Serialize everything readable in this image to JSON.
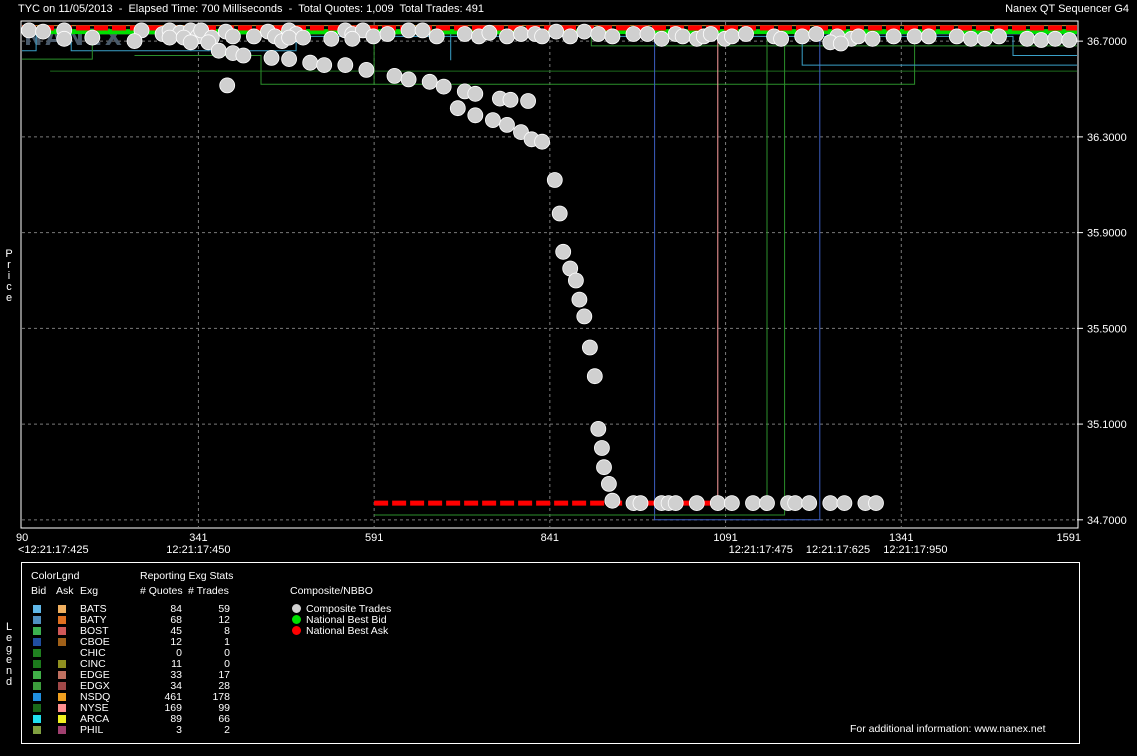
{
  "header": {
    "title_left": "TYC on 11/05/2013  -  Elapsed Time: 700 Milliseconds  -  Total Quotes: 1,009  Total Trades: 491",
    "title_right": "Nanex QT Sequencer G4",
    "watermark": "NANEX"
  },
  "side_labels": {
    "price": [
      "P",
      "r",
      "i",
      "c",
      "e"
    ],
    "legend": [
      "L",
      "e",
      "g",
      "e",
      "n",
      "d"
    ]
  },
  "colors": {
    "composite_trade": "#d0d0d0",
    "best_bid": "#00e000",
    "best_ask": "#ff0000",
    "grid": "#7a7a7a"
  },
  "chart_data": {
    "type": "scatter",
    "ylim": [
      34.67,
      36.78
    ],
    "xlim": [
      90,
      1591
    ],
    "y_ticks": [
      "36.7000",
      "36.3000",
      "35.9000",
      "35.5000",
      "35.1000",
      "34.7000"
    ],
    "y_tick_values": [
      36.7,
      36.3,
      35.9,
      35.5,
      35.1,
      34.7
    ],
    "x_ticks": [
      "90",
      "341",
      "591",
      "841",
      "1091",
      "1341",
      "1591"
    ],
    "x_tick_values": [
      90,
      341,
      591,
      841,
      1091,
      1341,
      1591
    ],
    "time_labels": [
      {
        "text": "<12:21:17:425",
        "x": 90
      },
      {
        "text": "12:21:17:450",
        "x": 341
      },
      {
        "text": "12:21:17:475",
        "x": 1141
      },
      {
        "text": "12:21:17:625",
        "x": 1251
      },
      {
        "text": "12:21:17:950",
        "x": 1361
      }
    ],
    "series": [
      {
        "name": "Composite Trades",
        "points": [
          [
            100,
            36.745
          ],
          [
            120,
            36.74
          ],
          [
            150,
            36.745
          ],
          [
            260,
            36.745
          ],
          [
            290,
            36.73
          ],
          [
            300,
            36.745
          ],
          [
            315,
            36.735
          ],
          [
            330,
            36.745
          ],
          [
            340,
            36.72
          ],
          [
            345,
            36.745
          ],
          [
            380,
            36.74
          ],
          [
            440,
            36.74
          ],
          [
            450,
            36.72
          ],
          [
            470,
            36.745
          ],
          [
            480,
            36.73
          ],
          [
            550,
            36.745
          ],
          [
            560,
            36.73
          ],
          [
            575,
            36.745
          ],
          [
            590,
            36.72
          ],
          [
            610,
            36.73
          ],
          [
            640,
            36.745
          ],
          [
            660,
            36.745
          ],
          [
            680,
            36.72
          ],
          [
            720,
            36.73
          ],
          [
            740,
            36.72
          ],
          [
            755,
            36.735
          ],
          [
            780,
            36.72
          ],
          [
            800,
            36.73
          ],
          [
            820,
            36.73
          ],
          [
            830,
            36.72
          ],
          [
            850,
            36.74
          ],
          [
            870,
            36.72
          ],
          [
            890,
            36.74
          ],
          [
            910,
            36.73
          ],
          [
            930,
            36.72
          ],
          [
            960,
            36.73
          ],
          [
            980,
            36.73
          ],
          [
            1000,
            36.71
          ],
          [
            1020,
            36.73
          ],
          [
            1030,
            36.72
          ],
          [
            1050,
            36.71
          ],
          [
            1060,
            36.72
          ],
          [
            1070,
            36.73
          ],
          [
            1090,
            36.71
          ],
          [
            1100,
            36.72
          ],
          [
            1120,
            36.73
          ],
          [
            1160,
            36.72
          ],
          [
            1170,
            36.71
          ],
          [
            1200,
            36.72
          ],
          [
            1220,
            36.73
          ],
          [
            1250,
            36.72
          ],
          [
            1270,
            36.71
          ],
          [
            1280,
            36.72
          ],
          [
            1300,
            36.71
          ],
          [
            1330,
            36.72
          ],
          [
            1360,
            36.72
          ],
          [
            1380,
            36.72
          ],
          [
            1420,
            36.72
          ],
          [
            1440,
            36.71
          ],
          [
            1460,
            36.71
          ],
          [
            1480,
            36.72
          ],
          [
            1520,
            36.71
          ],
          [
            1540,
            36.705
          ],
          [
            1560,
            36.71
          ],
          [
            1580,
            36.705
          ],
          [
            150,
            36.71
          ],
          [
            190,
            36.715
          ],
          [
            250,
            36.7
          ],
          [
            300,
            36.715
          ],
          [
            320,
            36.715
          ],
          [
            330,
            36.695
          ],
          [
            360,
            36.715
          ],
          [
            390,
            36.72
          ],
          [
            420,
            36.72
          ],
          [
            460,
            36.7
          ],
          [
            470,
            36.715
          ],
          [
            490,
            36.715
          ],
          [
            530,
            36.71
          ],
          [
            560,
            36.71
          ],
          [
            1240,
            36.695
          ],
          [
            1255,
            36.69
          ],
          [
            355,
            36.695
          ],
          [
            370,
            36.66
          ],
          [
            390,
            36.65
          ],
          [
            405,
            36.64
          ],
          [
            445,
            36.63
          ],
          [
            470,
            36.625
          ],
          [
            500,
            36.61
          ],
          [
            520,
            36.6
          ],
          [
            550,
            36.6
          ],
          [
            580,
            36.58
          ],
          [
            620,
            36.555
          ],
          [
            640,
            36.54
          ],
          [
            670,
            36.53
          ],
          [
            690,
            36.51
          ],
          [
            720,
            36.49
          ],
          [
            735,
            36.48
          ],
          [
            770,
            36.46
          ],
          [
            785,
            36.455
          ],
          [
            810,
            36.45
          ],
          [
            382,
            36.515
          ],
          [
            710,
            36.42
          ],
          [
            735,
            36.39
          ],
          [
            760,
            36.37
          ],
          [
            780,
            36.35
          ],
          [
            800,
            36.32
          ],
          [
            815,
            36.29
          ],
          [
            830,
            36.28
          ],
          [
            848,
            36.12
          ],
          [
            855,
            35.98
          ],
          [
            860,
            35.82
          ],
          [
            870,
            35.75
          ],
          [
            878,
            35.7
          ],
          [
            883,
            35.62
          ],
          [
            890,
            35.55
          ],
          [
            898,
            35.42
          ],
          [
            905,
            35.3
          ],
          [
            910,
            35.08
          ],
          [
            915,
            35.0
          ],
          [
            918,
            34.92
          ],
          [
            925,
            34.85
          ],
          [
            930,
            34.78
          ],
          [
            960,
            34.77
          ],
          [
            970,
            34.77
          ],
          [
            1000,
            34.77
          ],
          [
            1010,
            34.77
          ],
          [
            1020,
            34.77
          ],
          [
            1050,
            34.77
          ],
          [
            1080,
            34.77
          ],
          [
            1100,
            34.77
          ],
          [
            1130,
            34.77
          ],
          [
            1150,
            34.77
          ],
          [
            1180,
            34.77
          ],
          [
            1190,
            34.77
          ],
          [
            1210,
            34.77
          ],
          [
            1240,
            34.77
          ],
          [
            1260,
            34.77
          ],
          [
            1290,
            34.77
          ],
          [
            1305,
            34.77
          ]
        ]
      },
      {
        "name": "National Best Bid",
        "segments": [
          [
            [
              90,
              36.74
            ],
            [
              1591,
              36.74
            ]
          ]
        ]
      },
      {
        "name": "National Best Ask",
        "segments": [
          [
            [
              90,
              36.755
            ],
            [
              1591,
              36.755
            ]
          ],
          [
            [
              591,
              34.77
            ],
            [
              1110,
              34.77
            ]
          ]
        ]
      }
    ],
    "exchange_lines": [
      {
        "color": "#3aa0c8",
        "points": [
          [
            90,
            36.66
          ],
          [
            110,
            36.66
          ],
          [
            110,
            36.74
          ],
          [
            160,
            36.74
          ],
          [
            160,
            36.66
          ],
          [
            480,
            36.66
          ],
          [
            480,
            36.72
          ],
          [
            1500,
            36.72
          ],
          [
            1500,
            36.64
          ],
          [
            1591,
            36.64
          ]
        ]
      },
      {
        "color": "#2b8f2b",
        "points": [
          [
            90,
            36.625
          ],
          [
            190,
            36.625
          ],
          [
            190,
            36.73
          ],
          [
            900,
            36.73
          ],
          [
            900,
            36.68
          ],
          [
            1591,
            36.68
          ]
        ]
      },
      {
        "color": "#1c6b1c",
        "points": [
          [
            130,
            36.575
          ],
          [
            1591,
            36.575
          ]
        ]
      },
      {
        "color": "#2b8f2b",
        "points": [
          [
            250,
            36.64
          ],
          [
            430,
            36.64
          ],
          [
            430,
            36.52
          ],
          [
            1360,
            36.52
          ],
          [
            1360,
            36.73
          ],
          [
            1591,
            36.73
          ]
        ]
      },
      {
        "color": "#3c5ec0",
        "points": [
          [
            990,
            36.73
          ],
          [
            990,
            34.7
          ],
          [
            1225,
            34.7
          ],
          [
            1225,
            36.73
          ],
          [
            1591,
            36.73
          ]
        ]
      },
      {
        "color": "#2b8f2b",
        "points": [
          [
            591,
            34.72
          ],
          [
            1175,
            34.72
          ],
          [
            1175,
            36.72
          ]
        ]
      },
      {
        "color": "#3aa0c8",
        "points": [
          [
            700,
            36.62
          ],
          [
            700,
            36.74
          ],
          [
            1200,
            36.74
          ],
          [
            1200,
            36.6
          ],
          [
            1591,
            36.6
          ]
        ]
      },
      {
        "color": "#ffa0a0",
        "points": [
          [
            1080,
            34.77
          ],
          [
            1080,
            36.74
          ]
        ]
      },
      {
        "color": "#2b8f2b",
        "points": [
          [
            1150,
            34.77
          ],
          [
            1150,
            36.72
          ]
        ]
      },
      {
        "color": "#d09030",
        "points": [
          [
            90,
            36.765
          ],
          [
            1591,
            36.765
          ]
        ]
      },
      {
        "color": "#2b8f2b",
        "points": [
          [
            591,
            36.52
          ],
          [
            591,
            36.74
          ]
        ]
      }
    ]
  },
  "legend": {
    "headers": {
      "color_legend": "ColorLgnd",
      "bid": "Bid",
      "ask": "Ask",
      "exg": "Exg",
      "reporting": "Reporting Exg Stats",
      "quotes": "# Quotes",
      "trades": "# Trades",
      "composite": "Composite/NBBO"
    },
    "rows": [
      {
        "exg": "BATS",
        "quotes": "84",
        "trades": "59",
        "bid_color": "#60b8e8",
        "ask_color": "#f0b060"
      },
      {
        "exg": "BATY",
        "quotes": "68",
        "trades": "12",
        "bid_color": "#4f8fc0",
        "ask_color": "#e07020"
      },
      {
        "exg": "BOST",
        "quotes": "45",
        "trades": "8",
        "bid_color": "#3cb050",
        "ask_color": "#d05858"
      },
      {
        "exg": "CBOE",
        "quotes": "12",
        "trades": "1",
        "bid_color": "#204ea0",
        "ask_color": "#a06018"
      },
      {
        "exg": "CHIC",
        "quotes": "0",
        "trades": "0",
        "bid_color": "#208020",
        "ask_color": "#000000"
      },
      {
        "exg": "CINC",
        "quotes": "11",
        "trades": "0",
        "bid_color": "#1c7a1c",
        "ask_color": "#909020"
      },
      {
        "exg": "EDGE",
        "quotes": "33",
        "trades": "17",
        "bid_color": "#40b048",
        "ask_color": "#c07060"
      },
      {
        "exg": "EDGX",
        "quotes": "34",
        "trades": "28",
        "bid_color": "#3c9c3c",
        "ask_color": "#a04848"
      },
      {
        "exg": "NSDQ",
        "quotes": "461",
        "trades": "178",
        "bid_color": "#2090e0",
        "ask_color": "#f0a020"
      },
      {
        "exg": "NYSE",
        "quotes": "169",
        "trades": "99",
        "bid_color": "#1a6a1a",
        "ask_color": "#ff9090"
      },
      {
        "exg": "ARCA",
        "quotes": "89",
        "trades": "66",
        "bid_color": "#20e0f0",
        "ask_color": "#f0f020"
      },
      {
        "exg": "PHIL",
        "quotes": "3",
        "trades": "2",
        "bid_color": "#80a040",
        "ask_color": "#a04070"
      }
    ],
    "composite_items": [
      {
        "label": "Composite Trades",
        "color": "#d0d0d0"
      },
      {
        "label": "National Best Bid",
        "color": "#00e000"
      },
      {
        "label": "National Best Ask",
        "color": "#ff0000"
      }
    ],
    "footer": "For additional information: www.nanex.net"
  }
}
